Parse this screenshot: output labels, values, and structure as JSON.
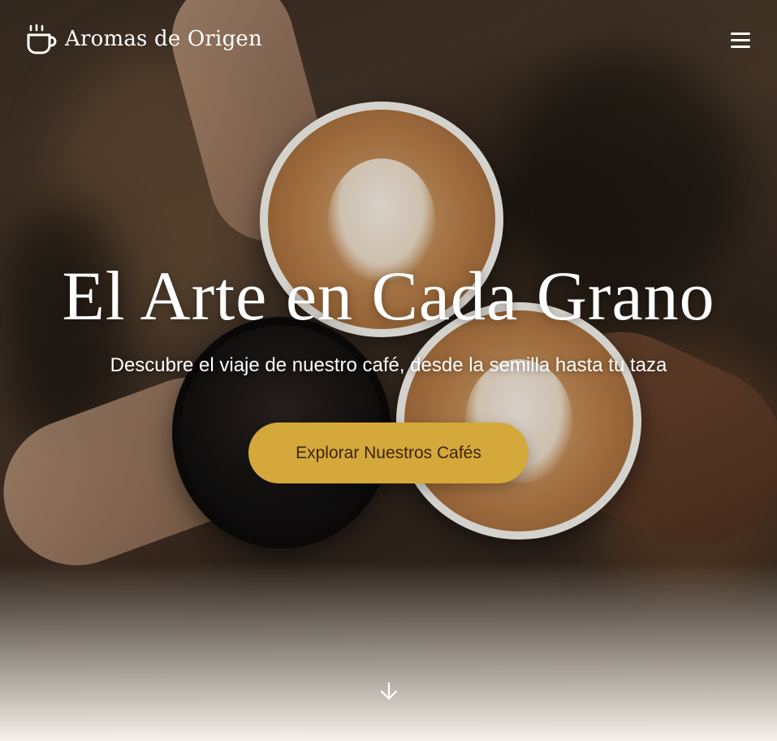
{
  "header": {
    "brand_name": "Aromas de Origen",
    "brand_icon": "coffee-cup-icon",
    "menu_icon": "hamburger-menu-icon"
  },
  "hero": {
    "title": "El Arte en Cada Grano",
    "subtitle": "Descubre el viaje de nuestro café, desde la semilla hasta tu taza",
    "cta_label": "Explorar Nuestros Cafés",
    "scroll_icon": "arrow-down-icon"
  },
  "colors": {
    "accent": "#d4a83a",
    "cta_text": "#3b2410",
    "text_light": "#ffffff",
    "page_background": "#f6f1ea"
  }
}
